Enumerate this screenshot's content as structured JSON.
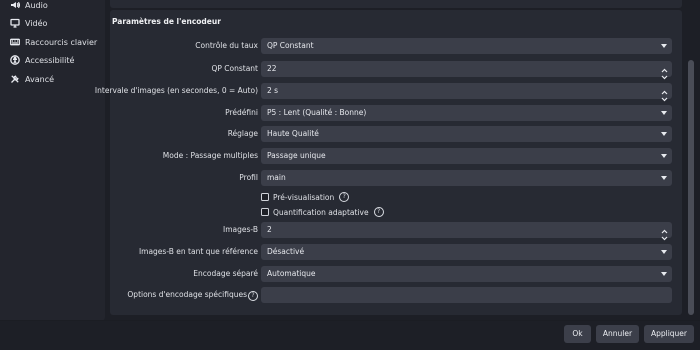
{
  "sidebar": {
    "items": [
      {
        "label": "Audio",
        "icon": "speaker-icon"
      },
      {
        "label": "Vidéo",
        "icon": "monitor-icon"
      },
      {
        "label": "Raccourcis clavier",
        "icon": "keyboard-icon"
      },
      {
        "label": "Accessibilité",
        "icon": "accessibility-icon"
      },
      {
        "label": "Avancé",
        "icon": "tools-icon"
      }
    ]
  },
  "panel": {
    "title": "Paramètres de l'encodeur",
    "fields": {
      "rate_control": {
        "label": "Contrôle du taux",
        "value": "QP Constant"
      },
      "qp_constant": {
        "label": "QP Constant",
        "value": "22"
      },
      "keyframe_interval": {
        "label": "Intervale d'images (en secondes, 0 = Auto)",
        "value": "2 s"
      },
      "preset": {
        "label": "Prédéfini",
        "value": "P5 : Lent (Qualité : Bonne)"
      },
      "tuning": {
        "label": "Réglage",
        "value": "Haute Qualité"
      },
      "multipass": {
        "label": "Mode : Passage multiples",
        "value": "Passage unique"
      },
      "profile": {
        "label": "Profil",
        "value": "main"
      },
      "lookahead": {
        "label": "Pré-visualisation",
        "checked": false
      },
      "adaptive_quant": {
        "label": "Quantification adaptative",
        "checked": false
      },
      "bframes": {
        "label": "Images-B",
        "value": "2"
      },
      "bframes_ref": {
        "label": "Images-B en tant que référence",
        "value": "Désactivé"
      },
      "split_encode": {
        "label": "Encodage séparé",
        "value": "Automatique"
      },
      "custom_options": {
        "label": "Options d'encodage spécifiques",
        "value": ""
      }
    }
  },
  "buttons": {
    "ok": "Ok",
    "cancel": "Annuler",
    "apply": "Appliquer"
  },
  "help_glyph": "?"
}
